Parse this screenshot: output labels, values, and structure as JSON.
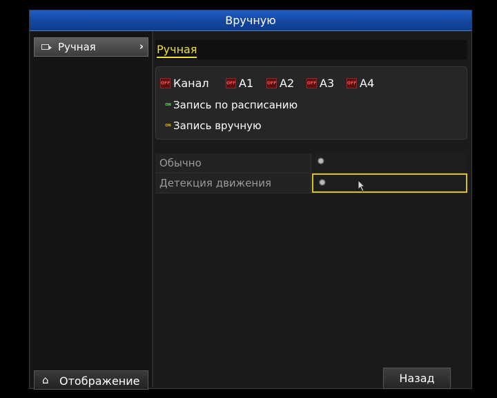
{
  "window": {
    "title": "Вручную"
  },
  "sidebar": {
    "items": [
      {
        "label": "Ручная",
        "icon": "camera-icon"
      }
    ],
    "display_button": {
      "label": "Отображение",
      "icon": "home-icon"
    }
  },
  "main": {
    "tab_label": "Ручная",
    "legend": {
      "channels": [
        {
          "state": "OFF",
          "label": "Канал"
        },
        {
          "state": "OFF",
          "label": "A1"
        },
        {
          "state": "OFF",
          "label": "A2"
        },
        {
          "state": "OFF",
          "label": "A3"
        },
        {
          "state": "OFF",
          "label": "A4"
        }
      ],
      "schedule_text": "Запись по расписанию",
      "schedule_icon_text": "ON",
      "manual_text": "Запись вручную",
      "manual_icon_text": "ON"
    },
    "rows": [
      {
        "label": "Обычно",
        "icon": "gear-icon",
        "selected": false
      },
      {
        "label": "Детекция движения",
        "icon": "gear-icon",
        "selected": true
      }
    ],
    "back_button": "Назад"
  },
  "colors": {
    "accent_blue": "#1346a0",
    "highlight_yellow": "#f0e030",
    "background": "#1b1b1b"
  }
}
